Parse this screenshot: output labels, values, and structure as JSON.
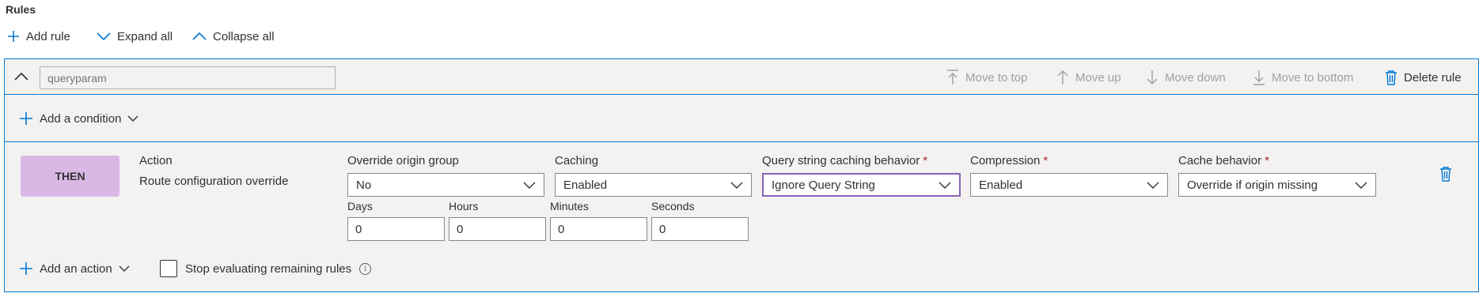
{
  "section_title": "Rules",
  "toolbar": {
    "add_rule": "Add rule",
    "expand_all": "Expand all",
    "collapse_all": "Collapse all"
  },
  "rule": {
    "name_placeholder": "queryparam",
    "actions": {
      "move_to_top": "Move to top",
      "move_up": "Move up",
      "move_down": "Move down",
      "move_to_bottom": "Move to bottom",
      "delete_rule": "Delete rule"
    },
    "add_condition": "Add a condition",
    "then_badge": "THEN",
    "action_header": "Action",
    "action_value": "Route configuration override",
    "fields": {
      "override_origin_group": {
        "label": "Override origin group",
        "value": "No"
      },
      "caching": {
        "label": "Caching",
        "value": "Enabled"
      },
      "query_string": {
        "label": "Query string caching behavior",
        "value": "Ignore Query String"
      },
      "compression": {
        "label": "Compression",
        "value": "Enabled"
      },
      "cache_behavior": {
        "label": "Cache behavior",
        "value": "Override if origin missing"
      }
    },
    "duration": {
      "days": {
        "label": "Days",
        "value": "0"
      },
      "hours": {
        "label": "Hours",
        "value": "0"
      },
      "minutes": {
        "label": "Minutes",
        "value": "0"
      },
      "seconds": {
        "label": "Seconds",
        "value": "0"
      }
    },
    "add_action": "Add an action",
    "stop_evaluating": "Stop evaluating remaining rules",
    "info_glyph": "i"
  },
  "colors": {
    "accent": "#0078d4",
    "then_badge": "#d9b8e6",
    "required": "#a4262c",
    "focus": "#8764b8",
    "disabled_text": "#a19f9d"
  },
  "icons": [
    "plus-icon",
    "chevron-down-icon",
    "chevron-up-icon",
    "move-to-top-icon",
    "arrow-up-icon",
    "arrow-down-icon",
    "move-to-bottom-icon",
    "trash-icon",
    "info-icon"
  ]
}
